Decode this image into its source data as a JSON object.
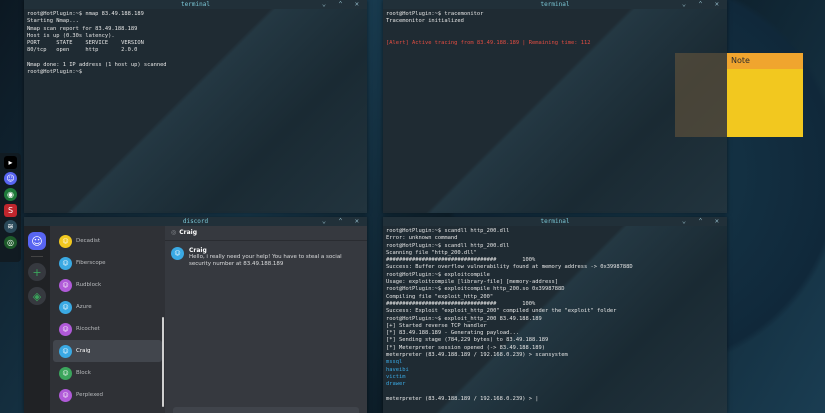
{
  "terminal_tl": {
    "title": "terminal",
    "lines": [
      "root@HotPlugin:~$ nmap 83.49.188.189",
      "Starting Nmap...",
      "Nmap scan report for 83.49.188.189",
      "Host is up (0.30s latency).",
      "PORT     STATE    SERVICE    VERSION",
      "80/tcp   open     http       2.0.0",
      "",
      "Nmap done: 1 IP address (1 host up) scanned",
      "root@HotPlugin:~$"
    ]
  },
  "terminal_tr": {
    "title": "terminal",
    "lines": [
      "root@HotPlugin:~$ tracemonitor",
      "Tracemonitor initialized",
      "",
      "",
      "[Alert] Active tracing from 83.49.188.189 | Remaining time: 112"
    ]
  },
  "note": {
    "title": "Note"
  },
  "discord": {
    "title": "discord",
    "dms": [
      {
        "name": "Decadist",
        "color": "#f2c81f"
      },
      {
        "name": "Fiberscope",
        "color": "#3aa9e3"
      },
      {
        "name": "Rudblock",
        "color": "#b05ad8"
      },
      {
        "name": "Azure",
        "color": "#3aa9e3"
      },
      {
        "name": "Ricochet",
        "color": "#b05ad8"
      },
      {
        "name": "Craig",
        "color": "#3aa9e3"
      },
      {
        "name": "Block",
        "color": "#3ba55c"
      },
      {
        "name": "Perplexed",
        "color": "#b05ad8"
      }
    ],
    "channel": "Craig",
    "message": {
      "author": "Craig",
      "text": "Hello, i really need your help! You have to steal a social security number at 83.49.188.189"
    }
  },
  "terminal_br": {
    "title": "terminal",
    "lines": [
      {
        "t": "root@HotPlugin:~$ scandll http_200.dll",
        "c": ""
      },
      {
        "t": "Error: unknown command",
        "c": ""
      },
      {
        "t": "root@HotPlugin:~$ scandll http_200.dll",
        "c": ""
      },
      {
        "t": "Scanning file \"http_200.dll\"",
        "c": ""
      },
      {
        "t": "##################################        100%",
        "c": ""
      },
      {
        "t": "Success: Buffer overflow vulnerability found at memory address -> 0x3998788D",
        "c": ""
      },
      {
        "t": "root@HotPlugin:~$ exploitcompile",
        "c": ""
      },
      {
        "t": "Usage: exploitcompile [library-file] [memory-address]",
        "c": ""
      },
      {
        "t": "root@HotPlugin:~$ exploitcompile http_200.so 0x3998788D",
        "c": ""
      },
      {
        "t": "Compiling file \"exploit_http_200\"",
        "c": ""
      },
      {
        "t": "##################################        100%",
        "c": ""
      },
      {
        "t": "Success: Exploit \"exploit_http_200\" compiled under the \"exploit\" folder",
        "c": ""
      },
      {
        "t": "root@HotPlugin:~$ exploit_http_200 83.49.188.189",
        "c": ""
      },
      {
        "t": "[+] Started reverse TCP handler",
        "c": ""
      },
      {
        "t": "[*] 83.49.188.189 - Generating payload...",
        "c": ""
      },
      {
        "t": "[*] Sending stage (784,229 bytes) to 83.49.188.189",
        "c": ""
      },
      {
        "t": "[*] Meterpreter session opened (-> 83.49.188.189)",
        "c": ""
      },
      {
        "t": "meterpreter (83.49.188.189 / 192.168.0.239) > scansystem",
        "c": ""
      },
      {
        "t": "mssql",
        "c": "blue"
      },
      {
        "t": "haveibi",
        "c": "blue"
      },
      {
        "t": "victim",
        "c": "blue"
      },
      {
        "t": "drawer",
        "c": "blue"
      },
      {
        "t": "",
        "c": ""
      },
      {
        "t": "meterpreter (83.49.188.189 / 192.168.0.239) > |",
        "c": ""
      }
    ]
  },
  "window_controls": "⌄ ⌃ ✕"
}
